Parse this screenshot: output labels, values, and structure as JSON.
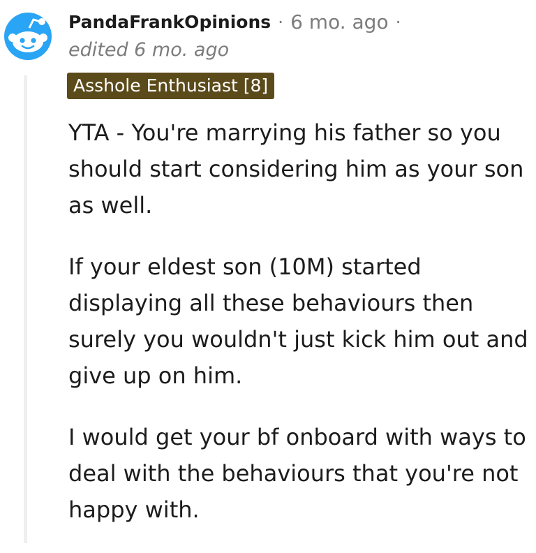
{
  "comment": {
    "username": "PandaFrankOpinions",
    "separator": "·",
    "time": "6 mo. ago",
    "edited": "edited 6 mo. ago",
    "flair": "Asshole Enthusiast [8]",
    "paragraphs": [
      "YTA - You're marrying his father so you should start considering him as your son as well.",
      "If your eldest son (10M) started displaying all these behaviours then surely you wouldn't just kick him out and give up on him.",
      "I would get your bf onboard with ways to deal with the behaviours that you're not happy with."
    ]
  },
  "colors": {
    "flair_bg": "#5b4a1a",
    "meta_text": "#7c7c7c",
    "avatar_blue": "#2a9df4",
    "thread_line": "#edeff1"
  },
  "icons": {
    "avatar": "reddit-snoo-avatar-icon"
  }
}
